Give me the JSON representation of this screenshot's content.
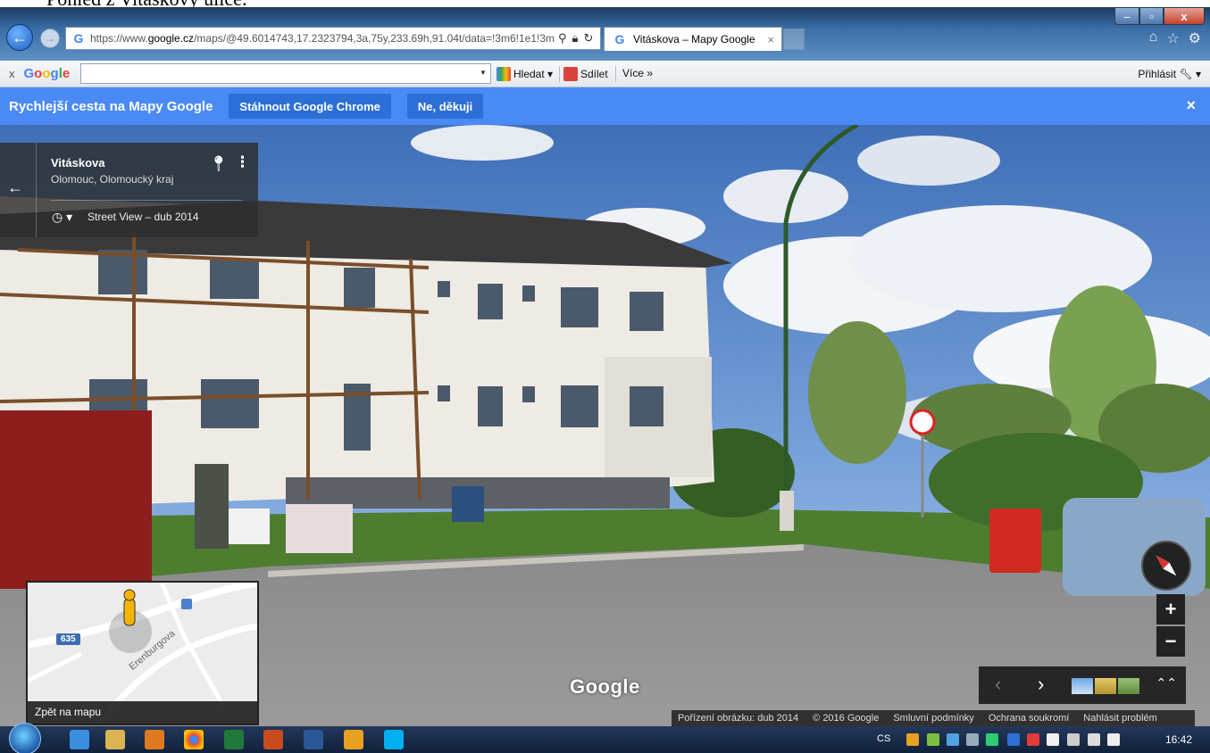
{
  "caption_partial": "Pohled z Vitáskovy ulice:",
  "browser": {
    "url_prefix": "https://www.",
    "url_domain": "google.cz",
    "url_rest": "/maps/@49.6014743,17.2323794,3a,75y,233.69h,91.04t/data=!3m6!1e1!3m4",
    "tab_title": "Vitáskova – Mapy Google",
    "tab_close": "×"
  },
  "google_toolbar": {
    "close": "x",
    "logo": "Google",
    "search_value": "",
    "search_label": "Hledat",
    "share_label": "Sdílet",
    "more_label": "Více »",
    "signin_label": "Přihlásit"
  },
  "promo": {
    "text": "Rychlejší cesta na Mapy Google",
    "download_button": "Stáhnout Google Chrome",
    "decline_button": "Ne, děkuji",
    "close": "×"
  },
  "info_card": {
    "title": "Vitáskova",
    "subtitle": "Olomouc, Olomoucký kraj",
    "street_view_date": "Street View – dub 2014"
  },
  "minimap": {
    "road_shield": "635",
    "street_name": "Erenburgova",
    "back_label": "Zpět na mapu"
  },
  "controls": {
    "zoom_in": "+",
    "zoom_out": "−",
    "prev": "‹",
    "next": "›",
    "expand": "⌃⌃"
  },
  "watermark": "Google",
  "footer": {
    "capture_date": "Pořízení obrázku: dub 2014",
    "copyright": "© 2016 Google",
    "terms": "Smluvní podmínky",
    "privacy": "Ochrana soukromí",
    "report": "Nahlásit problém"
  },
  "taskbar": {
    "lang": "CS",
    "clock": "16:42"
  },
  "colors": {
    "promo_blue": "#4a8af4",
    "promo_button": "#2d6fd6",
    "overlay_dark": "#2d2d2d"
  }
}
